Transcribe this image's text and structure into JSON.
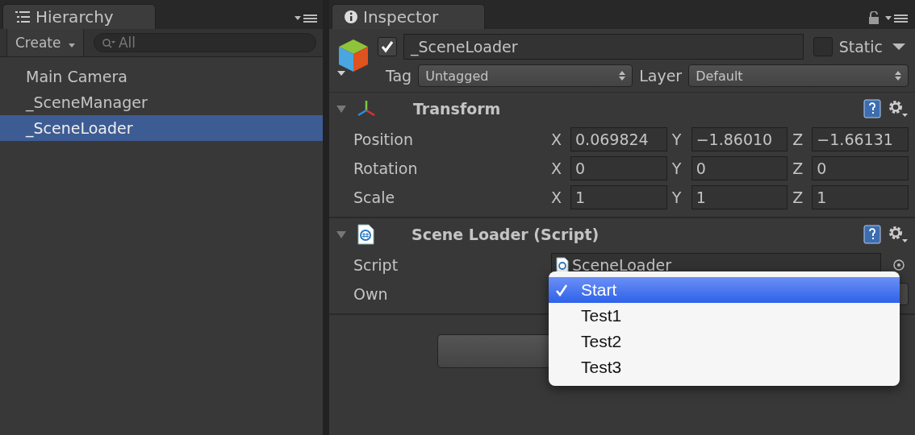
{
  "hierarchy": {
    "tab_title": "Hierarchy",
    "create_button": "Create",
    "search": {
      "placeholder": "All"
    },
    "items": [
      {
        "label": "Main Camera",
        "selected": false
      },
      {
        "label": "_SceneManager",
        "selected": false
      },
      {
        "label": "_SceneLoader",
        "selected": true
      }
    ]
  },
  "inspector": {
    "tab_title": "Inspector",
    "object": {
      "active": true,
      "name": "_SceneLoader",
      "static": false,
      "static_label": "Static",
      "tag_label": "Tag",
      "tag": "Untagged",
      "layer_label": "Layer",
      "layer": "Default"
    },
    "components": [
      {
        "kind": "transform",
        "title": "Transform",
        "expanded": true,
        "rows": [
          {
            "label": "Position",
            "axes": [
              {
                "axis": "X",
                "value": "0.069824"
              },
              {
                "axis": "Y",
                "value": "−1.86010"
              },
              {
                "axis": "Z",
                "value": "−1.66131"
              }
            ]
          },
          {
            "label": "Rotation",
            "axes": [
              {
                "axis": "X",
                "value": "0"
              },
              {
                "axis": "Y",
                "value": "0"
              },
              {
                "axis": "Z",
                "value": "0"
              }
            ]
          },
          {
            "label": "Scale",
            "axes": [
              {
                "axis": "X",
                "value": "1"
              },
              {
                "axis": "Y",
                "value": "1"
              },
              {
                "axis": "Z",
                "value": "1"
              }
            ]
          }
        ]
      },
      {
        "kind": "script",
        "title": "Scene Loader (Script)",
        "expanded": true,
        "fields": [
          {
            "kind": "object",
            "label": "Script",
            "value": "SceneLoader"
          },
          {
            "kind": "dropdown",
            "label": "Own"
          }
        ]
      }
    ]
  },
  "popup": {
    "options": [
      {
        "label": "Start",
        "selected": true
      },
      {
        "label": "Test1",
        "selected": false
      },
      {
        "label": "Test2",
        "selected": false
      },
      {
        "label": "Test3",
        "selected": false
      }
    ]
  }
}
